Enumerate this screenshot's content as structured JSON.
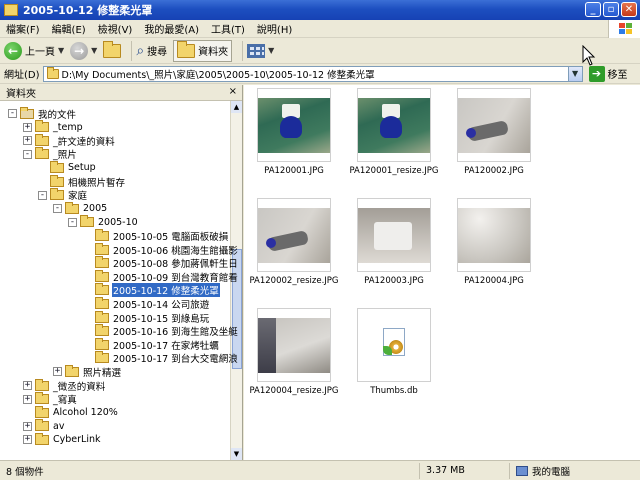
{
  "window": {
    "title": "2005-10-12 修整柔光罩",
    "controls": {
      "minimize": "_",
      "maximize": "▫",
      "close": "✕"
    }
  },
  "menu": [
    "檔案(F)",
    "編輯(E)",
    "檢視(V)",
    "我的最愛(A)",
    "工具(T)",
    "說明(H)"
  ],
  "toolbar": {
    "back_label": "上一頁",
    "search_label": "搜尋",
    "folders_label": "資料夾"
  },
  "address": {
    "label": "網址(D)",
    "value": "D:\\My Documents\\_照片\\家庭\\2005\\2005-10\\2005-10-12 修整柔光罩",
    "go_label": "移至"
  },
  "folder_pane": {
    "title": "資料夾",
    "close": "×",
    "tree": [
      {
        "label": "我的文件",
        "depth": 0,
        "toggle": "-",
        "selected": false
      },
      {
        "label": "_temp",
        "depth": 1,
        "toggle": "+",
        "selected": false
      },
      {
        "label": "_許文達的資料",
        "depth": 1,
        "toggle": "+",
        "selected": false
      },
      {
        "label": "_照片",
        "depth": 1,
        "toggle": "-",
        "selected": false
      },
      {
        "label": "Setup",
        "depth": 2,
        "toggle": "",
        "selected": false
      },
      {
        "label": "相機照片暫存",
        "depth": 2,
        "toggle": "",
        "selected": false
      },
      {
        "label": "家庭",
        "depth": 2,
        "toggle": "-",
        "selected": false
      },
      {
        "label": "2005",
        "depth": 3,
        "toggle": "-",
        "selected": false
      },
      {
        "label": "2005-10",
        "depth": 4,
        "toggle": "-",
        "selected": false
      },
      {
        "label": "2005-10-05 電腦面板破損",
        "depth": 5,
        "toggle": "",
        "selected": false
      },
      {
        "label": "2005-10-06 桃園海生館攝影",
        "depth": 5,
        "toggle": "",
        "selected": false
      },
      {
        "label": "2005-10-08 參加蔣佩軒生日",
        "depth": 5,
        "toggle": "",
        "selected": false
      },
      {
        "label": "2005-10-09 到台灣教育館看",
        "depth": 5,
        "toggle": "",
        "selected": false
      },
      {
        "label": "2005-10-12 修整柔光罩",
        "depth": 5,
        "toggle": "",
        "selected": true
      },
      {
        "label": "2005-10-14 公司旅遊",
        "depth": 5,
        "toggle": "",
        "selected": false
      },
      {
        "label": "2005-10-15 到綠島玩",
        "depth": 5,
        "toggle": "",
        "selected": false
      },
      {
        "label": "2005-10-16 到海生館及坐艇",
        "depth": 5,
        "toggle": "",
        "selected": false
      },
      {
        "label": "2005-10-17 在家烤牡蠣",
        "depth": 5,
        "toggle": "",
        "selected": false
      },
      {
        "label": "2005-10-17 到台大交電網浪",
        "depth": 5,
        "toggle": "",
        "selected": false
      },
      {
        "label": "照片精選",
        "depth": 3,
        "toggle": "+",
        "selected": false
      },
      {
        "label": "_徵丞的資料",
        "depth": 1,
        "toggle": "+",
        "selected": false
      },
      {
        "label": "_寫真",
        "depth": 1,
        "toggle": "+",
        "selected": false
      },
      {
        "label": "Alcohol 120%",
        "depth": 1,
        "toggle": "",
        "selected": false
      },
      {
        "label": "av",
        "depth": 1,
        "toggle": "+",
        "selected": false
      },
      {
        "label": "CyberLink",
        "depth": 1,
        "toggle": "+",
        "selected": false
      }
    ]
  },
  "files": [
    {
      "name": "PA120001.JPG",
      "photo": "green"
    },
    {
      "name": "PA120001_resize.JPG",
      "photo": "green"
    },
    {
      "name": "PA120002.JPG",
      "photo": "grey"
    },
    {
      "name": "PA120002_resize.JPG",
      "photo": "grey"
    },
    {
      "name": "PA120003.JPG",
      "photo": "box"
    },
    {
      "name": "PA120004.JPG",
      "photo": "curve"
    },
    {
      "name": "PA120004_resize.JPG",
      "photo": "dark"
    },
    {
      "name": "Thumbs.db",
      "photo": "db"
    }
  ],
  "status": {
    "count": "8 個物件",
    "size": "3.37 MB",
    "location": "我的電腦"
  }
}
